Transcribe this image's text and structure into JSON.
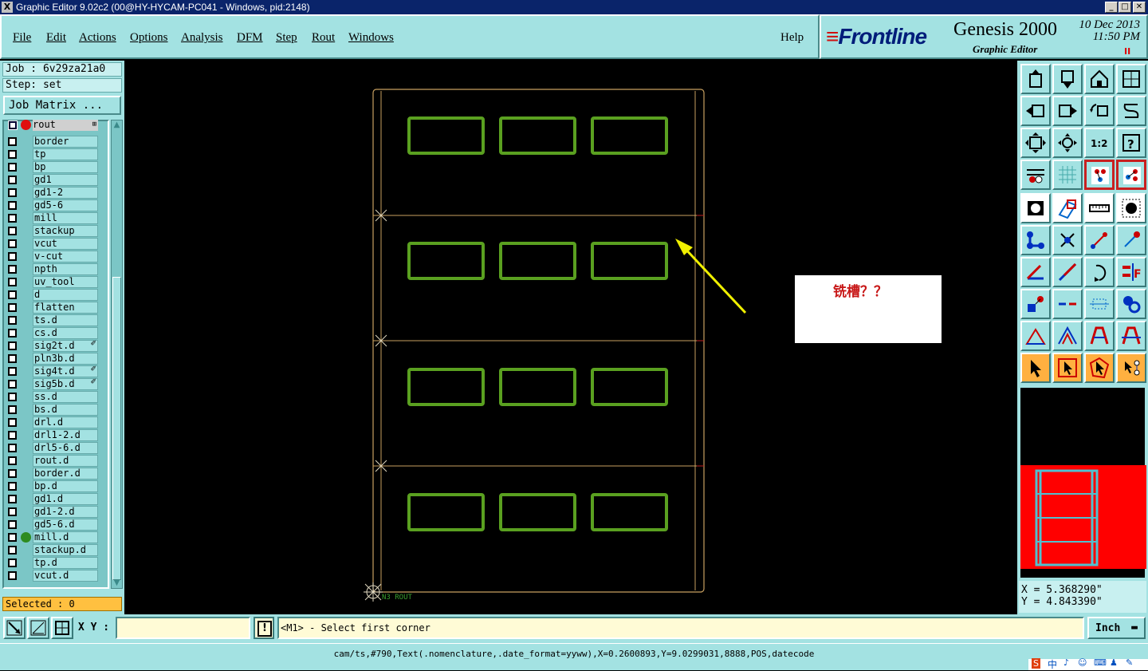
{
  "window": {
    "title": "Graphic Editor 9.02c2 (00@HY-HYCAM-PC041 - Windows, pid:2148)",
    "buttons": [
      "_",
      "□",
      "✕"
    ]
  },
  "menu": {
    "items": [
      "File",
      "Edit",
      "Actions",
      "Options",
      "Analysis",
      "DFM",
      "Step",
      "Rout",
      "Windows"
    ],
    "help": "Help"
  },
  "brand": {
    "logo": "Frontline",
    "product": "Genesis 2000",
    "subtitle": "Graphic Editor",
    "date": "10 Dec 2013",
    "time": "11:50 PM",
    "pause": "II"
  },
  "job": {
    "job_label": "Job : 6v29za21a0",
    "step_label": "Step: set",
    "matrix_button": "Job Matrix ..."
  },
  "layers": {
    "active": "rout",
    "active_marker": "⊞",
    "items": [
      {
        "name": "border",
        "dot": "",
        "flag": ""
      },
      {
        "name": "tp",
        "dot": "",
        "flag": ""
      },
      {
        "name": "bp",
        "dot": "",
        "flag": ""
      },
      {
        "name": "gd1",
        "dot": "",
        "flag": ""
      },
      {
        "name": "gd1-2",
        "dot": "",
        "flag": ""
      },
      {
        "name": "gd5-6",
        "dot": "",
        "flag": ""
      },
      {
        "name": "mill",
        "dot": "",
        "flag": ""
      },
      {
        "name": "stackup",
        "dot": "",
        "flag": ""
      },
      {
        "name": "vcut",
        "dot": "",
        "flag": ""
      },
      {
        "name": "v-cut",
        "dot": "",
        "flag": ""
      },
      {
        "name": "npth",
        "dot": "",
        "flag": ""
      },
      {
        "name": "uv_tool",
        "dot": "",
        "flag": ""
      },
      {
        "name": "d",
        "dot": "",
        "flag": ""
      },
      {
        "name": "flatten",
        "dot": "",
        "flag": ""
      },
      {
        "name": "ts.d",
        "dot": "",
        "flag": ""
      },
      {
        "name": "cs.d",
        "dot": "",
        "flag": ""
      },
      {
        "name": "sig2t.d",
        "dot": "",
        "flag": "✐"
      },
      {
        "name": "pln3b.d",
        "dot": "",
        "flag": ""
      },
      {
        "name": "sig4t.d",
        "dot": "",
        "flag": "✐"
      },
      {
        "name": "sig5b.d",
        "dot": "",
        "flag": "✐"
      },
      {
        "name": "ss.d",
        "dot": "",
        "flag": ""
      },
      {
        "name": "bs.d",
        "dot": "",
        "flag": ""
      },
      {
        "name": "drl.d",
        "dot": "",
        "flag": ""
      },
      {
        "name": "drl1-2.d",
        "dot": "",
        "flag": ""
      },
      {
        "name": "drl5-6.d",
        "dot": "",
        "flag": ""
      },
      {
        "name": "rout.d",
        "dot": "",
        "flag": ""
      },
      {
        "name": "border.d",
        "dot": "",
        "flag": ""
      },
      {
        "name": "bp.d",
        "dot": "",
        "flag": ""
      },
      {
        "name": "gd1.d",
        "dot": "",
        "flag": ""
      },
      {
        "name": "gd1-2.d",
        "dot": "",
        "flag": ""
      },
      {
        "name": "gd5-6.d",
        "dot": "",
        "flag": ""
      },
      {
        "name": "mill.d",
        "dot": "#2e8b20",
        "flag": ""
      },
      {
        "name": "stackup.d",
        "dot": "",
        "flag": ""
      },
      {
        "name": "tp.d",
        "dot": "",
        "flag": ""
      },
      {
        "name": "vcut.d",
        "dot": "",
        "flag": ""
      }
    ]
  },
  "selected": "Selected : 0",
  "canvas": {
    "origin_label": "N3  ROUT",
    "colors": {
      "outline": "#c8a060",
      "slot": "#5aa020",
      "arrow": "#f0f000",
      "edge": "#c02020"
    }
  },
  "annotation": {
    "text": "铣槽？？"
  },
  "coords": {
    "x": "X = 5.368290\"",
    "y": "Y = 4.843390\""
  },
  "bottom": {
    "xy_label": "X Y :",
    "xy_value": "",
    "warn": "!",
    "prompt": "<M1> - Select first corner",
    "units": "Inch",
    "units_arrow": "▬"
  },
  "status": "cam/ts,#790,Text(.nomenclature,.date_format=yyww),X=0.2600893,Y=9.0299031,8888,POS,datecode",
  "tray": {
    "labels": [
      "S",
      "中",
      "♪",
      "☺",
      "⌨",
      "♟",
      "✎"
    ]
  }
}
